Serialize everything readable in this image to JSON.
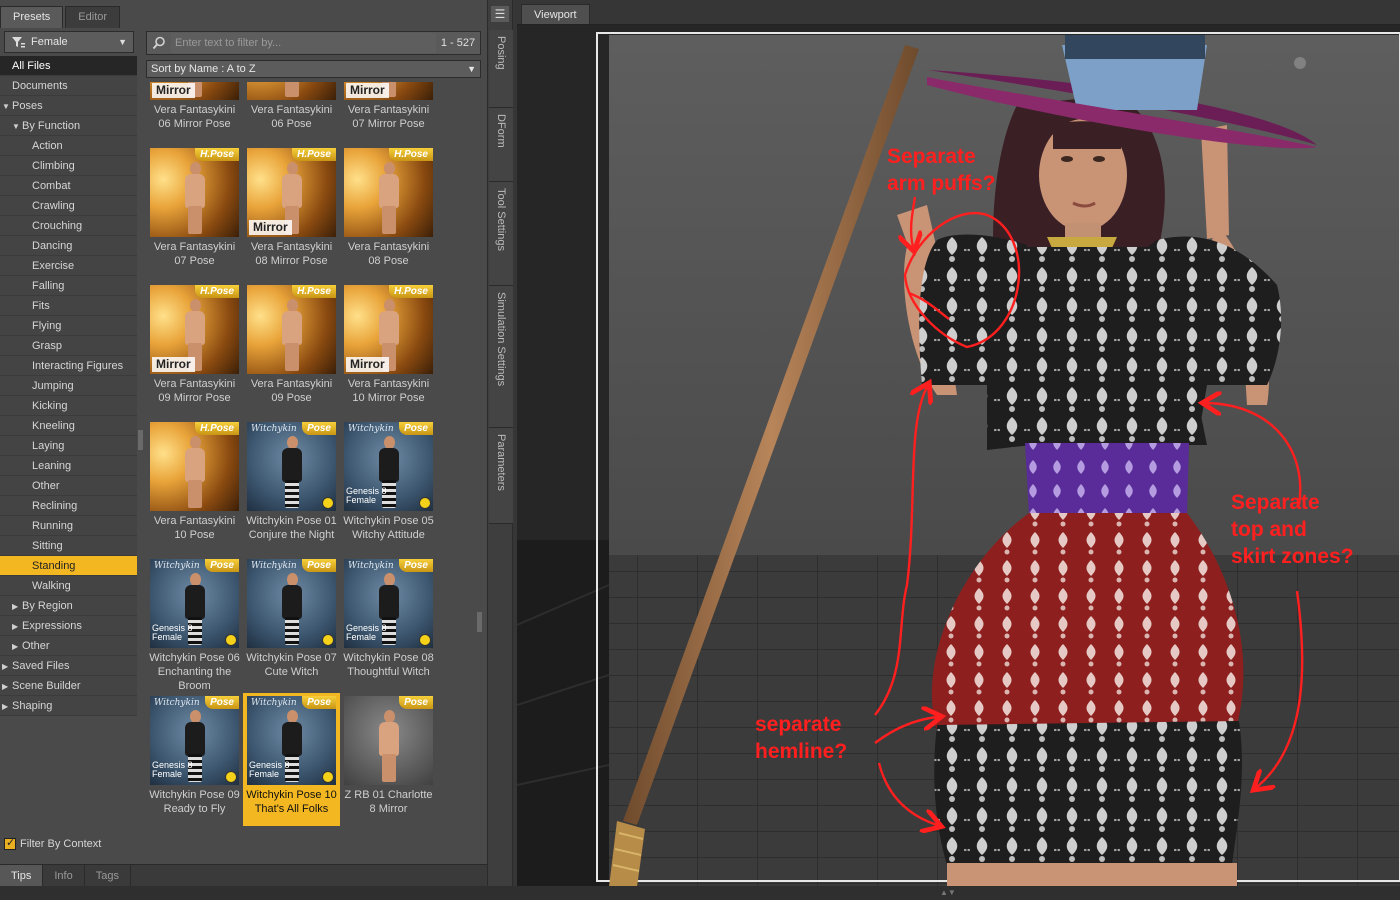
{
  "top_tabs": [
    "Presets",
    "Editor"
  ],
  "category": {
    "selected": "Female"
  },
  "tree": [
    {
      "label": "All Files",
      "level": 0,
      "arrow": "",
      "state": "selected-dark"
    },
    {
      "label": "Documents",
      "level": 0,
      "arrow": "",
      "state": ""
    },
    {
      "label": "Poses",
      "level": "0e",
      "arrow": "▼",
      "state": ""
    },
    {
      "label": "By Function",
      "level": 1,
      "arrow": "▼",
      "state": ""
    },
    {
      "label": "Action",
      "level": 2,
      "arrow": "",
      "state": ""
    },
    {
      "label": "Climbing",
      "level": 2,
      "arrow": "",
      "state": ""
    },
    {
      "label": "Combat",
      "level": 2,
      "arrow": "",
      "state": ""
    },
    {
      "label": "Crawling",
      "level": 2,
      "arrow": "",
      "state": ""
    },
    {
      "label": "Crouching",
      "level": 2,
      "arrow": "",
      "state": ""
    },
    {
      "label": "Dancing",
      "level": 2,
      "arrow": "",
      "state": ""
    },
    {
      "label": "Exercise",
      "level": 2,
      "arrow": "",
      "state": ""
    },
    {
      "label": "Falling",
      "level": 2,
      "arrow": "",
      "state": ""
    },
    {
      "label": "Fits",
      "level": 2,
      "arrow": "",
      "state": ""
    },
    {
      "label": "Flying",
      "level": 2,
      "arrow": "",
      "state": ""
    },
    {
      "label": "Grasp",
      "level": 2,
      "arrow": "",
      "state": ""
    },
    {
      "label": "Interacting Figures",
      "level": 2,
      "arrow": "",
      "state": ""
    },
    {
      "label": "Jumping",
      "level": 2,
      "arrow": "",
      "state": ""
    },
    {
      "label": "Kicking",
      "level": 2,
      "arrow": "",
      "state": ""
    },
    {
      "label": "Kneeling",
      "level": 2,
      "arrow": "",
      "state": ""
    },
    {
      "label": "Laying",
      "level": 2,
      "arrow": "",
      "state": ""
    },
    {
      "label": "Leaning",
      "level": 2,
      "arrow": "",
      "state": ""
    },
    {
      "label": "Other",
      "level": 2,
      "arrow": "",
      "state": ""
    },
    {
      "label": "Reclining",
      "level": 2,
      "arrow": "",
      "state": ""
    },
    {
      "label": "Running",
      "level": 2,
      "arrow": "",
      "state": ""
    },
    {
      "label": "Sitting",
      "level": 2,
      "arrow": "",
      "state": ""
    },
    {
      "label": "Standing",
      "level": 2,
      "arrow": "",
      "state": "selected"
    },
    {
      "label": "Walking",
      "level": 2,
      "arrow": "",
      "state": ""
    },
    {
      "label": "By Region",
      "level": 1,
      "arrow": "▶",
      "state": ""
    },
    {
      "label": "Expressions",
      "level": 1,
      "arrow": "▶",
      "state": ""
    },
    {
      "label": "Other",
      "level": 1,
      "arrow": "▶",
      "state": ""
    },
    {
      "label": "Saved Files",
      "level": "0e",
      "arrow": "▶",
      "state": ""
    },
    {
      "label": "Scene Builder",
      "level": "0e",
      "arrow": "▶",
      "state": ""
    },
    {
      "label": "Shaping",
      "level": "0e",
      "arrow": "▶",
      "state": ""
    }
  ],
  "filter_by_context": "Filter By Context",
  "search": {
    "placeholder": "Enter text to filter by...",
    "count": "1 - 527"
  },
  "sort": {
    "label": "Sort by Name : A to Z"
  },
  "tiles": [
    {
      "caption": "Vera Fantasykini\n06 Mirror Pose",
      "style": "gold",
      "badge": "",
      "mirror": "Mirror",
      "partial": true
    },
    {
      "caption": "Vera Fantasykini\n06 Pose",
      "style": "gold",
      "badge": "",
      "mirror": "",
      "partial": true
    },
    {
      "caption": "Vera Fantasykini\n07 Mirror Pose",
      "style": "gold",
      "badge": "",
      "mirror": "Mirror",
      "partial": true
    },
    {
      "caption": "Vera Fantasykini\n07 Pose",
      "style": "gold",
      "badge": "H.Pose",
      "mirror": ""
    },
    {
      "caption": "Vera Fantasykini\n08 Mirror Pose",
      "style": "gold",
      "badge": "H.Pose",
      "mirror": "Mirror"
    },
    {
      "caption": "Vera Fantasykini\n08 Pose",
      "style": "gold",
      "badge": "H.Pose",
      "mirror": ""
    },
    {
      "caption": "Vera Fantasykini\n09 Mirror Pose",
      "style": "gold",
      "badge": "H.Pose",
      "mirror": "Mirror"
    },
    {
      "caption": "Vera Fantasykini\n09 Pose",
      "style": "gold",
      "badge": "H.Pose",
      "mirror": ""
    },
    {
      "caption": "Vera Fantasykini\n10 Mirror Pose",
      "style": "gold",
      "badge": "H.Pose",
      "mirror": "Mirror"
    },
    {
      "caption": "Vera Fantasykini\n10 Pose",
      "style": "gold",
      "badge": "H.Pose",
      "mirror": ""
    },
    {
      "caption": "Witchykin Pose 01\nConjure the Night",
      "style": "blue",
      "badge": "Pose",
      "mirror": "",
      "smiley": true
    },
    {
      "caption": "Witchykin Pose 05\nWitchy Attitude",
      "style": "blue",
      "badge": "Pose",
      "mirror": "",
      "gen": "Genesis 8\nFemale",
      "smiley": true
    },
    {
      "caption": "Witchykin Pose 06\nEnchanting the\nBroom",
      "style": "blue",
      "badge": "Pose",
      "mirror": "",
      "gen": "Genesis 8\nFemale",
      "smiley": true
    },
    {
      "caption": "Witchykin Pose 07\nCute Witch",
      "style": "blue",
      "badge": "Pose",
      "mirror": "",
      "smiley": true
    },
    {
      "caption": "Witchykin Pose 08\nThoughtful Witch",
      "style": "blue",
      "badge": "Pose",
      "mirror": "",
      "gen": "Genesis 8\nFemale",
      "smiley": true
    },
    {
      "caption": "Witchykin Pose 09\nReady to Fly",
      "style": "blue",
      "badge": "Pose",
      "mirror": "",
      "gen": "Genesis 8\nFemale",
      "smiley": true
    },
    {
      "caption": "Witchykin Pose 10\nThat's All Folks",
      "style": "blue",
      "badge": "Pose",
      "mirror": "",
      "gen": "Genesis 8\nFemale",
      "smiley": true,
      "selected": true
    },
    {
      "caption": "Z RB 01 Charlotte\n8 Mirror",
      "style": "grey",
      "badge": "Pose",
      "mirror": ""
    }
  ],
  "tile_script_text": "Witchykin",
  "bottom_tabs": [
    "Tips",
    "Info",
    "Tags"
  ],
  "side_tabs": [
    "Posing",
    "DForm",
    "Tool Settings",
    "Simulation Settings",
    "Parameters"
  ],
  "viewport": {
    "tab_label": "Viewport",
    "annotations": {
      "arm": "Separate\narm puffs?",
      "top_skirt": "Separate\ntop and\nskirt zones?",
      "hem": "separate\nhemline?"
    },
    "annotation_color": "#ff1f1f"
  },
  "colors": {
    "accent": "#f3b722"
  }
}
